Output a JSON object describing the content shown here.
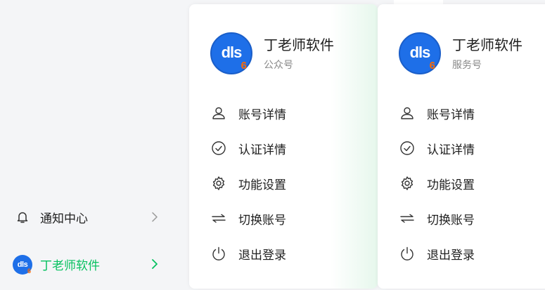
{
  "sidebar": {
    "notify_label": "通知中心",
    "account_label": "丁老师软件",
    "account_logo_text": "dls",
    "account_logo_sub": "6",
    "accent_color": "#07c160"
  },
  "cards": [
    {
      "logo_text": "dls",
      "logo_sub": "6",
      "name": "丁老师软件",
      "type": "公众号",
      "menu": [
        "账号详情",
        "认证详情",
        "功能设置",
        "切换账号",
        "退出登录"
      ]
    },
    {
      "logo_text": "dls",
      "logo_sub": "6",
      "name": "丁老师软件",
      "type": "服务号",
      "menu": [
        "账号详情",
        "认证详情",
        "功能设置",
        "切换账号",
        "退出登录"
      ]
    }
  ],
  "icons": [
    "bell-icon",
    "chevron-right-icon",
    "user-icon",
    "check-circle-icon",
    "gear-icon",
    "switch-icon",
    "power-icon"
  ]
}
